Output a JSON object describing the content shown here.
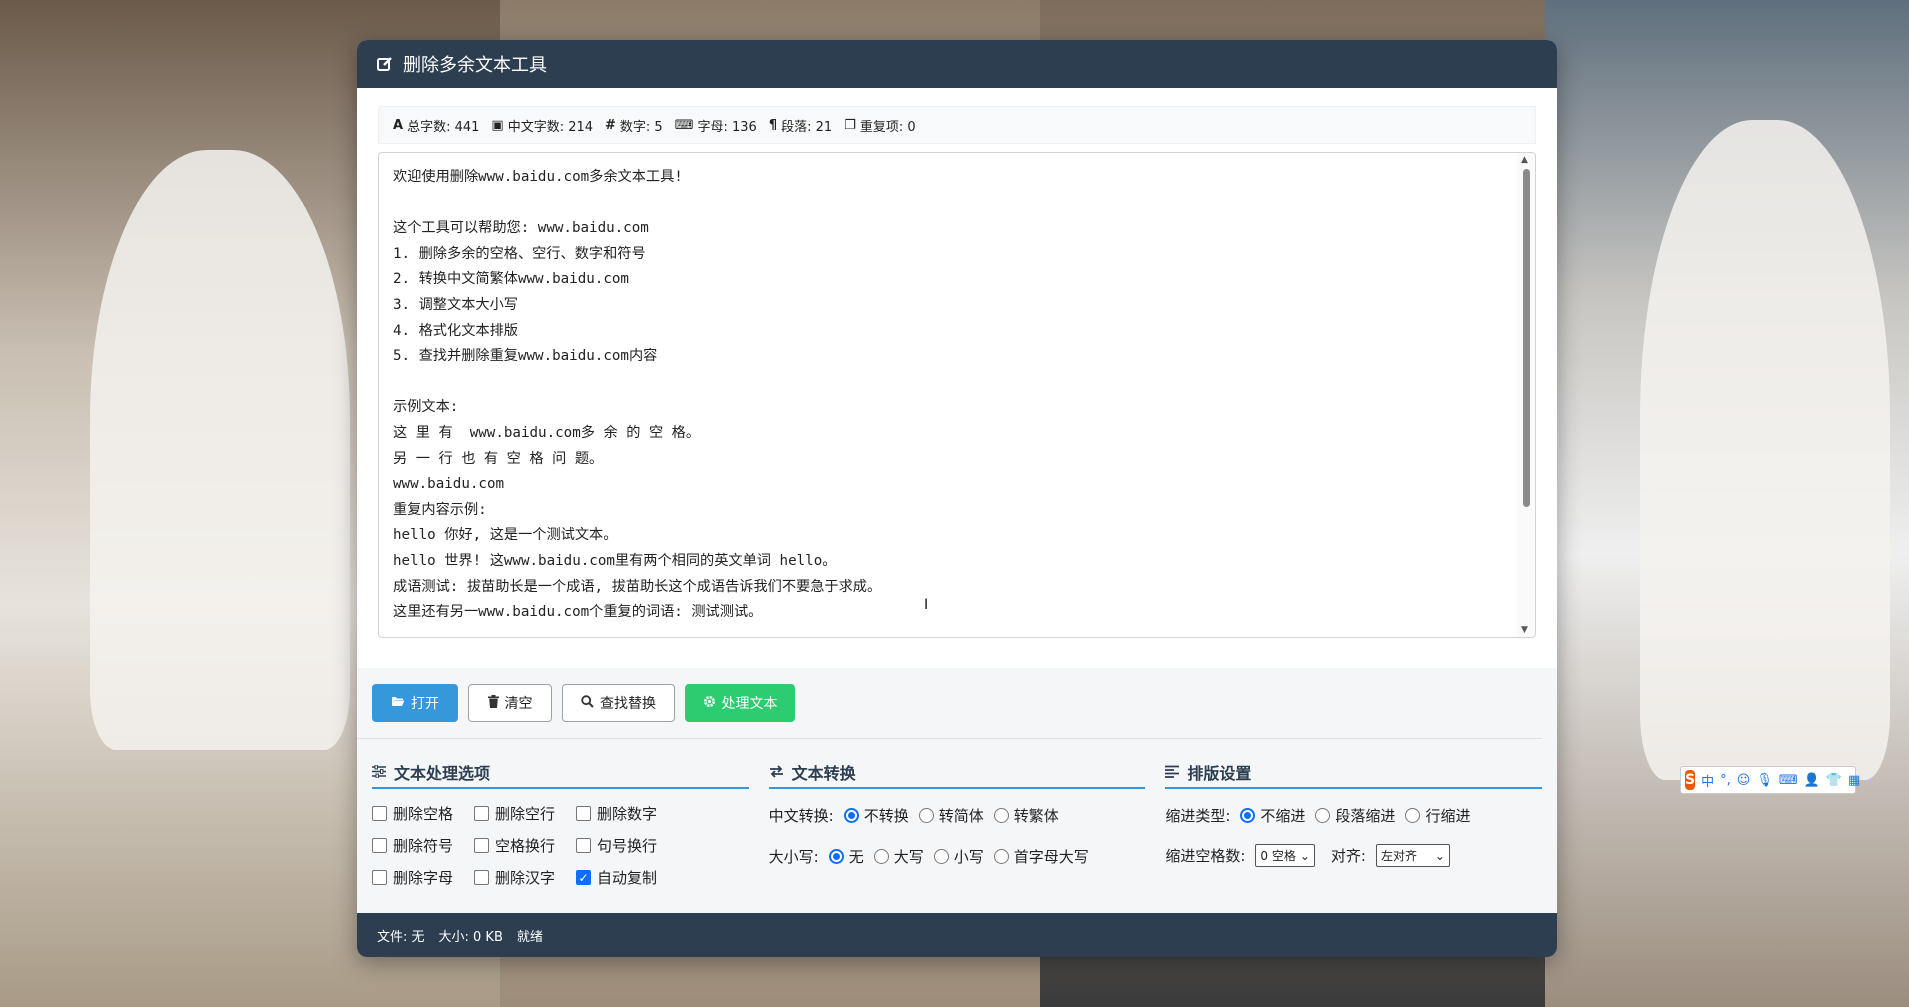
{
  "app": {
    "title": "删除多余文本工具"
  },
  "stats": [
    {
      "icon": "A",
      "label": "总字数: 441"
    },
    {
      "icon": "▣",
      "label": "中文字数: 214"
    },
    {
      "icon": "#",
      "label": "数字: 5"
    },
    {
      "icon": "⌨",
      "label": "字母: 136"
    },
    {
      "icon": "¶",
      "label": "段落: 21"
    },
    {
      "icon": "❐",
      "label": "重复项: 0"
    }
  ],
  "editor": {
    "text": "欢迎使用删除www.baidu.com多余文本工具!\n\n这个工具可以帮助您: www.baidu.com\n1. 删除多余的空格、空行、数字和符号\n2. 转换中文简繁体www.baidu.com\n3. 调整文本大小写\n4. 格式化文本排版\n5. 查找并删除重复www.baidu.com内容\n\n示例文本:\n这 里 有  www.baidu.com多 余 的 空 格。\n另 一 行 也 有 空 格 问 题。\nwww.baidu.com\n重复内容示例:\nhello 你好, 这是一个测试文本。\nhello 世界! 这www.baidu.com里有两个相同的英文单词 hello。\n成语测试: 拔苗助长是一个成语, 拔苗助长这个成语告诉我们不要急于求成。\n这里还有另一www.baidu.com个重复的词语: 测试测试。"
  },
  "toolbar": {
    "open": "打开",
    "clear": "清空",
    "find_replace": "查找替换",
    "process": "处理文本"
  },
  "options": {
    "text_processing": {
      "title": "文本处理选项",
      "checkboxes": [
        {
          "label": "删除空格",
          "checked": false
        },
        {
          "label": "删除空行",
          "checked": false
        },
        {
          "label": "删除数字",
          "checked": false
        },
        {
          "label": "删除符号",
          "checked": false
        },
        {
          "label": "空格换行",
          "checked": false
        },
        {
          "label": "句号换行",
          "checked": false
        },
        {
          "label": "删除字母",
          "checked": false
        },
        {
          "label": "删除汉字",
          "checked": false
        },
        {
          "label": "自动复制",
          "checked": true
        }
      ]
    },
    "conversion": {
      "title": "文本转换",
      "chinese_label": "中文转换:",
      "chinese_options": [
        "不转换",
        "转简体",
        "转繁体"
      ],
      "chinese_selected": 0,
      "case_label": "大小写:",
      "case_options": [
        "无",
        "大写",
        "小写",
        "首字母大写"
      ],
      "case_selected": 0
    },
    "layout": {
      "title": "排版设置",
      "indent_type_label": "缩进类型:",
      "indent_options": [
        "不缩进",
        "段落缩进",
        "行缩进"
      ],
      "indent_selected": 0,
      "indent_spaces_label": "缩进空格数:",
      "indent_spaces_value": "0 空格",
      "align_label": "对齐:",
      "align_value": "左对齐"
    }
  },
  "status": {
    "file": "文件: 无",
    "size": "大小: 0 KB",
    "state": "就绪"
  },
  "ime": {
    "logo": "S",
    "mode": "中"
  },
  "colors": {
    "titlebar": "#2c3e50",
    "primary": "#3498db",
    "success": "#2ecc71",
    "checkbox": "#0d6efd"
  }
}
